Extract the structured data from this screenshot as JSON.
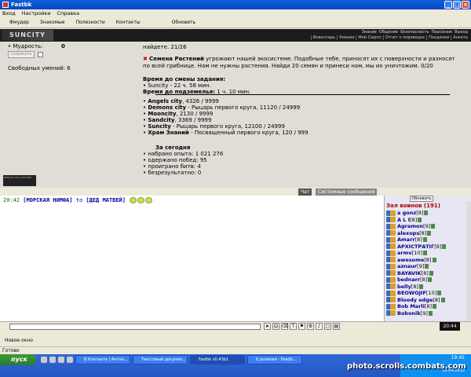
{
  "window": {
    "title": "Fastbk"
  },
  "menu": [
    "Вход",
    "Настройки",
    "Справка"
  ],
  "toolbar": [
    "Фмудер",
    "Знакомые",
    "Полезности",
    "Контакты",
    "Обновить"
  ],
  "game_header": {
    "logo": "SUNCITY",
    "nav_top": [
      "Знание",
      "Общение",
      "Безопасность",
      "Персонаж",
      "Выход"
    ],
    "nav_bottom": [
      "Инвентарь",
      "Умения",
      "Мой Сюрпл",
      "Отчет о переводах",
      "Поединки",
      "Анкета"
    ]
  },
  "left_panel": {
    "wisdom_label": "• Мудрость:",
    "wisdom_value": "0",
    "save_label": "сохранить",
    "free_skills": "Свободных умений: 6",
    "mini_banner": "ВЕРТЬИ 2421 ОНЛАЙН"
  },
  "quest": {
    "find_line": "найдете. 21/26",
    "threat_name": "Семена Растений",
    "threat_text": "угрожают нашей экосистеме. Подобные тебе, приносят их с поверхности и разносят по всей грибнице. Нам не нужны растения. Найди 20 семян и принеси нам, мы их уничтожим. 0/20",
    "change_time_label": "Время до смены задания:",
    "change_time_item": "• Suncity - 22 ч. 58 мин.",
    "underground_label": "Время до подземелья:",
    "underground_value": "1 ч. 10 мин."
  },
  "cities": [
    {
      "name": "Angels city",
      "desc": ", 4326 / 9999"
    },
    {
      "name": "Demons city",
      "desc": " - Рыцарь первого круга, 11120 / 24999"
    },
    {
      "name": "Mooncity",
      "desc": ", 2130 / 9999"
    },
    {
      "name": "Sandcity",
      "desc": ", 3369 / 9999"
    },
    {
      "name": "Suncity",
      "desc": " - Рыцарь первого круга, 12100 / 24999"
    },
    {
      "name": "Храм Знаний",
      "desc": " - Посвященный первого круга, 120 / 999"
    }
  ],
  "today": {
    "title": "За сегодня",
    "stats": [
      "• набрано опыта: 1 021 276",
      "• одержано побед: 95",
      "• проиграно битв: 4",
      "• безрезультатно: 0"
    ]
  },
  "chat_tabs": {
    "chat": "Чат",
    "system": "Системные сообщения"
  },
  "chat": {
    "time": "20:42",
    "nick": "[МОРСКАЯ НИМФА]",
    "to": "to",
    "target": "[ДЕД МАТВЕЙ]"
  },
  "warriors": {
    "refresh_label": "Обновить",
    "hall_title": "Зал воинов (191)",
    "list": [
      {
        "name": "a gonz",
        "level": "[8]"
      },
      {
        "name": "A L I",
        "level": "[8]"
      },
      {
        "name": "Agramon",
        "level": "[9]"
      },
      {
        "name": "alexops",
        "level": "[8]"
      },
      {
        "name": "Amarr",
        "level": "[8]"
      },
      {
        "name": "АРХІСТРАТІГ",
        "level": "[8]"
      },
      {
        "name": "armv",
        "level": "[10]"
      },
      {
        "name": "awesome",
        "level": "[8]"
      },
      {
        "name": "aznaur",
        "level": "[9]"
      },
      {
        "name": "BAYAVIK",
        "level": "[8]"
      },
      {
        "name": "bednarr",
        "level": "[8]"
      },
      {
        "name": "belly",
        "level": "[8]"
      },
      {
        "name": "BEOWOJIF",
        "level": "[10]"
      },
      {
        "name": "Bloody edge",
        "level": "[8]"
      },
      {
        "name": "Bob Marli",
        "level": "[8]"
      },
      {
        "name": "Bobonik",
        "level": "[9]"
      }
    ]
  },
  "input_clock": "20:44",
  "new_window_label": "Новое окно",
  "status": "Готово",
  "taskbar": {
    "start": "пуск",
    "tasks": [
      "В Контакте | Антон...",
      "Текстовый докумен...",
      "Fastbk v0.43b1",
      "6 розмови - Feedb..."
    ],
    "time": "19:45",
    "date": "12.04.2010",
    "watermark": "photo.scrolls.combats.com"
  }
}
